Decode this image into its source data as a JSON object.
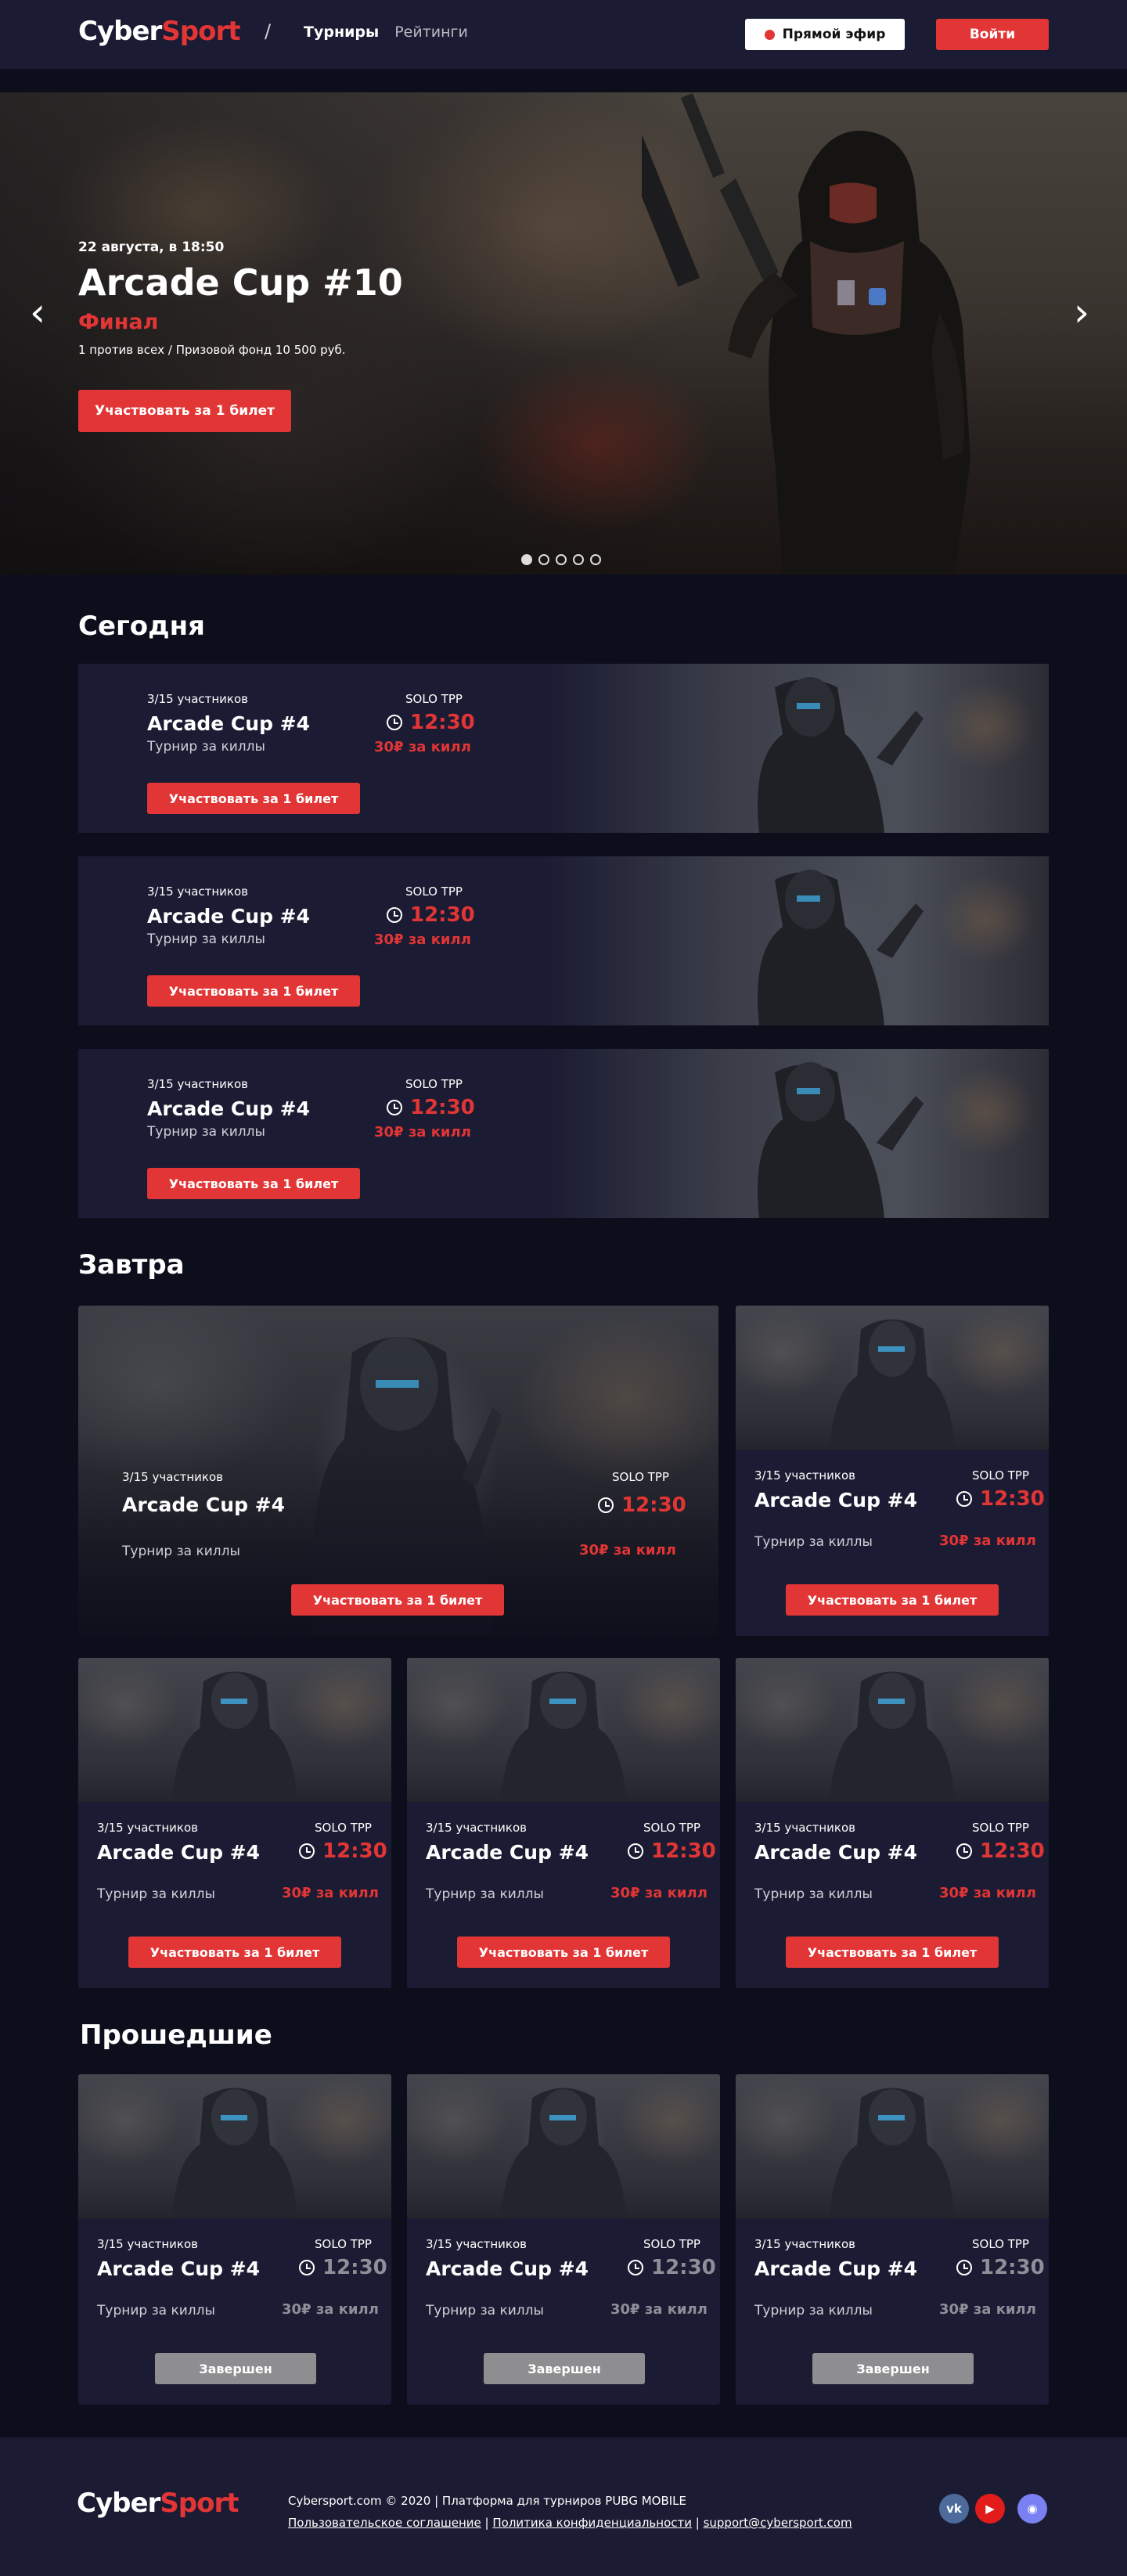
{
  "header": {
    "logo_a": "Cyber",
    "logo_b": "Sport",
    "nav": [
      "Турниры",
      "Рейтинги"
    ],
    "live": "Прямой эфир",
    "login": "Войти"
  },
  "hero": {
    "date": "22 августа, в 18:50",
    "title": "Arcade Cup #10",
    "subtitle": "Финал",
    "desc": "1 против всех / Призовой фонд 10 500 руб.",
    "cta": "Участвовать за 1 билет",
    "slides": 5,
    "active_slide": 1
  },
  "sections": {
    "today": "Сегодня",
    "tomorrow": "Завтра",
    "past": "Прошедшие"
  },
  "today": [
    {
      "players": "3/15 участников",
      "name": "Arcade Cup #4",
      "kind": "Турнир за киллы",
      "mode": "SOLO TPP",
      "time": "12:30",
      "prize": "30₽ за килл",
      "cta": "Участвовать за 1 билет"
    },
    {
      "players": "3/15 участников",
      "name": "Arcade Cup #4",
      "kind": "Турнир за киллы",
      "mode": "SOLO TPP",
      "time": "12:30",
      "prize": "30₽ за килл",
      "cta": "Участвовать за 1 билет"
    },
    {
      "players": "3/15 участников",
      "name": "Arcade Cup #4",
      "kind": "Турнир за киллы",
      "mode": "SOLO TPP",
      "time": "12:30",
      "prize": "30₽ за килл",
      "cta": "Участвовать за 1 билет"
    }
  ],
  "tomorrow": [
    {
      "players": "3/15 участников",
      "name": "Arcade Cup #4",
      "kind": "Турнир за киллы",
      "mode": "SOLO TPP",
      "time": "12:30",
      "prize": "30₽ за килл",
      "cta": "Участвовать за 1 билет"
    },
    {
      "players": "3/15 участников",
      "name": "Arcade Cup #4",
      "kind": "Турнир за киллы",
      "mode": "SOLO TPP",
      "time": "12:30",
      "prize": "30₽ за килл",
      "cta": "Участвовать за 1 билет"
    },
    {
      "players": "3/15 участников",
      "name": "Arcade Cup #4",
      "kind": "Турнир за киллы",
      "mode": "SOLO TPP",
      "time": "12:30",
      "prize": "30₽ за килл",
      "cta": "Участвовать за 1 билет"
    },
    {
      "players": "3/15 участников",
      "name": "Arcade Cup #4",
      "kind": "Турнир за киллы",
      "mode": "SOLO TPP",
      "time": "12:30",
      "prize": "30₽ за килл",
      "cta": "Участвовать за 1 билет"
    },
    {
      "players": "3/15 участников",
      "name": "Arcade Cup #4",
      "kind": "Турнир за киллы",
      "mode": "SOLO TPP",
      "time": "12:30",
      "prize": "30₽ за килл",
      "cta": "Участвовать за 1 билет"
    }
  ],
  "past": [
    {
      "players": "3/15 участников",
      "name": "Arcade Cup #4",
      "kind": "Турнир за киллы",
      "mode": "SOLO TPP",
      "time": "12:30",
      "prize": "30₽ за килл",
      "status": "Завершен"
    },
    {
      "players": "3/15 участников",
      "name": "Arcade Cup #4",
      "kind": "Турнир за киллы",
      "mode": "SOLO TPP",
      "time": "12:30",
      "prize": "30₽ за килл",
      "status": "Завершен"
    },
    {
      "players": "3/15 участников",
      "name": "Arcade Cup #4",
      "kind": "Турнир за киллы",
      "mode": "SOLO TPP",
      "time": "12:30",
      "prize": "30₽ за килл",
      "status": "Завершен"
    }
  ],
  "footer": {
    "logo_a": "Cyber",
    "logo_b": "Sport",
    "copy": "Cybersport.com © 2020 | Платформа для турниров PUBG MOBILE",
    "links": [
      "Пользовательское соглашение",
      "Политика конфиденциальности",
      "support@cybersport.com"
    ],
    "social": [
      "vk-icon",
      "youtube-icon",
      "discord-icon"
    ]
  },
  "colors": {
    "accent": "#e23535",
    "bg": "#0d0e1c",
    "panel": "#1b1c33",
    "muted": "#8e8f98"
  }
}
